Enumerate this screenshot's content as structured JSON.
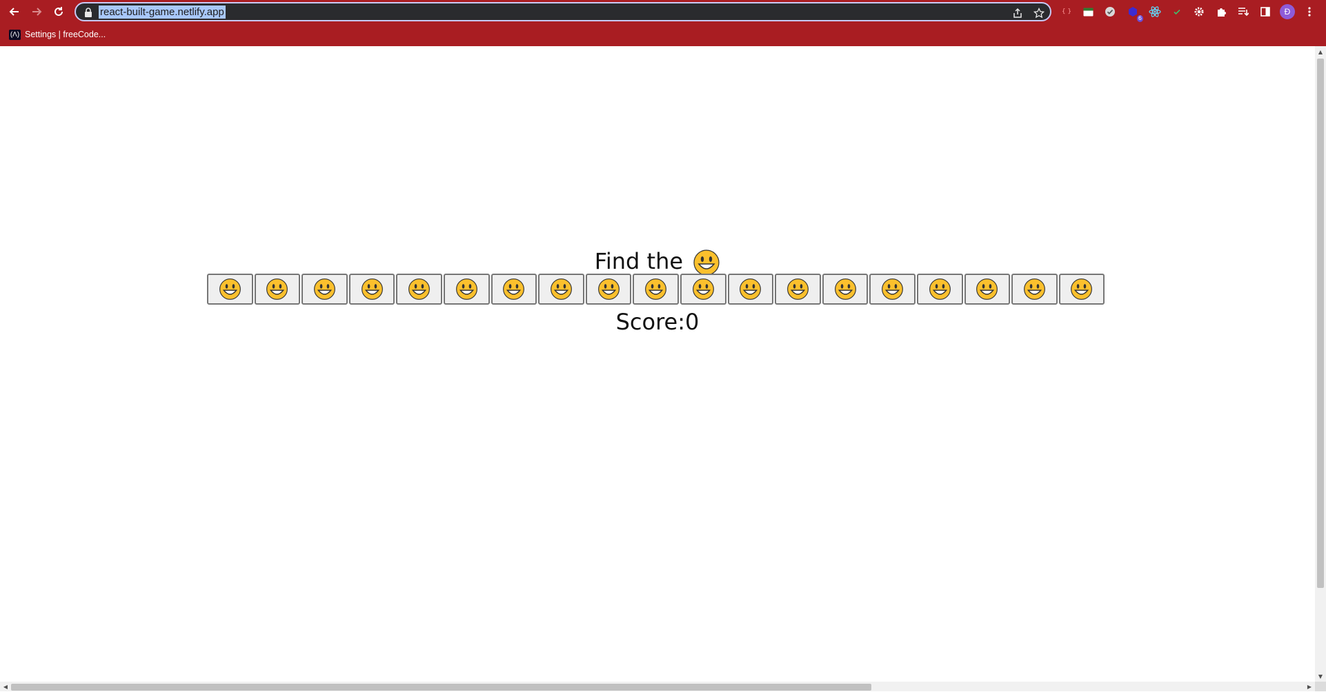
{
  "browser": {
    "url": "react-built-game.netlify.app",
    "bookmark_label": "Settings | freeCode...",
    "profile_initial": "Đ",
    "extension_badge": "6",
    "colors": {
      "frame": "#a91d22",
      "omnibox": "#2a2b2e"
    }
  },
  "game": {
    "title": "Find the",
    "target_emoji": "grinning-face-icon",
    "cells": [
      {
        "emoji": "grinning-face-icon"
      },
      {
        "emoji": "grinning-face-icon"
      },
      {
        "emoji": "grinning-face-icon"
      },
      {
        "emoji": "grinning-face-icon"
      },
      {
        "emoji": "grinning-face-icon"
      },
      {
        "emoji": "grinning-face-icon"
      },
      {
        "emoji": "grinning-face-icon"
      },
      {
        "emoji": "grinning-face-icon"
      },
      {
        "emoji": "grinning-face-icon"
      },
      {
        "emoji": "grinning-face-icon"
      },
      {
        "emoji": "grinning-face-icon"
      },
      {
        "emoji": "grinning-face-icon"
      },
      {
        "emoji": "grinning-face-icon"
      },
      {
        "emoji": "grinning-face-icon"
      },
      {
        "emoji": "grinning-face-icon"
      },
      {
        "emoji": "grinning-face-icon"
      },
      {
        "emoji": "grinning-face-icon"
      },
      {
        "emoji": "grinning-face-icon"
      },
      {
        "emoji": "grinning-face-icon"
      }
    ],
    "score_label": "Score:0"
  }
}
